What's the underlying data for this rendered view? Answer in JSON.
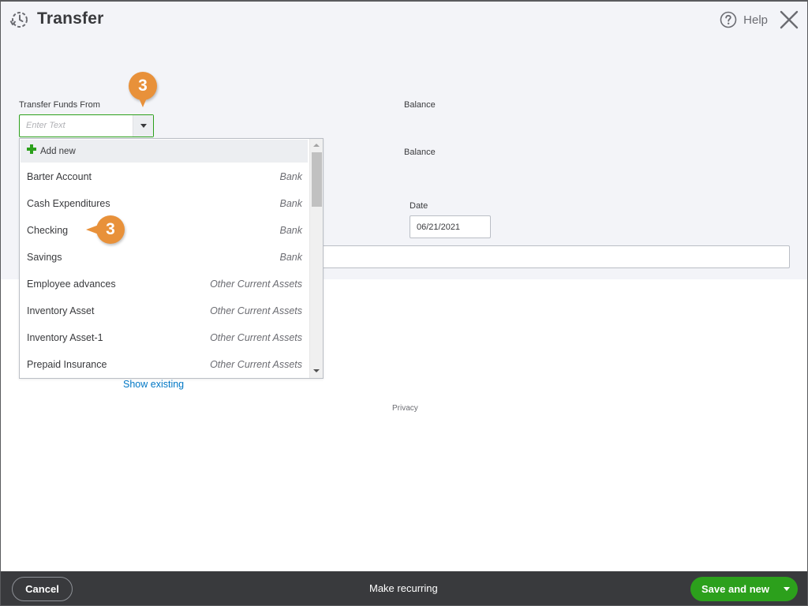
{
  "header": {
    "title": "Transfer",
    "help_label": "Help"
  },
  "form": {
    "transfer_from_label": "Transfer Funds From",
    "transfer_from_placeholder": "Enter Text",
    "balance_label_1": "Balance",
    "balance_label_2": "Balance",
    "date_label": "Date",
    "date_value": "06/21/2021"
  },
  "dropdown": {
    "add_new_label": "Add new",
    "items": [
      {
        "name": "Barter Account",
        "type": "Bank"
      },
      {
        "name": "Cash Expenditures",
        "type": "Bank"
      },
      {
        "name": "Checking",
        "type": "Bank"
      },
      {
        "name": "Savings",
        "type": "Bank"
      },
      {
        "name": "Employee advances",
        "type": "Other Current Assets"
      },
      {
        "name": "Inventory Asset",
        "type": "Other Current Assets"
      },
      {
        "name": "Inventory Asset-1",
        "type": "Other Current Assets"
      },
      {
        "name": "Prepaid Insurance",
        "type": "Other Current Assets"
      }
    ]
  },
  "links": {
    "show_existing": "Show existing",
    "privacy": "Privacy"
  },
  "footer": {
    "cancel_label": "Cancel",
    "make_recurring_label": "Make recurring",
    "save_label": "Save and new"
  },
  "callouts": {
    "step_1": "3",
    "step_2": "3"
  },
  "colors": {
    "accent_green": "#2ca01c",
    "callout_orange": "#e8913a",
    "link_blue": "#0077c5",
    "footer_bg": "#393a3d"
  }
}
